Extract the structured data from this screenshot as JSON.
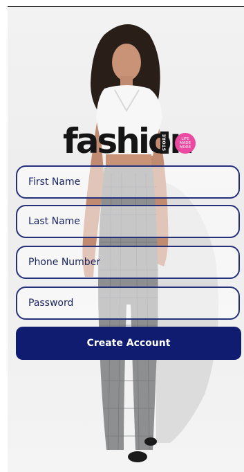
{
  "brand": {
    "logo_word": "fashion",
    "logo_vertical": "STORE",
    "badge_lines": [
      "LIFE",
      "MADE",
      "MORE"
    ],
    "badge_color": "#ea4aa0"
  },
  "form": {
    "fields": [
      {
        "placeholder": "First Name"
      },
      {
        "placeholder": "Last Name"
      },
      {
        "placeholder": "Phone Number"
      },
      {
        "placeholder": "Password"
      }
    ],
    "submit_label": "Create Account",
    "field_border_color": "#24307a",
    "button_color": "#0f1c70"
  }
}
